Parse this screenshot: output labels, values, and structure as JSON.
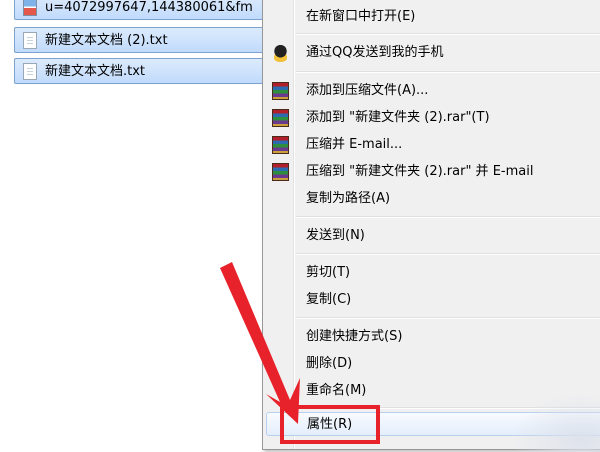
{
  "files": [
    {
      "name": "u=4072997647,144380061&fm",
      "icon": "image-file-icon"
    },
    {
      "name": "新建文本文档 (2).txt",
      "icon": "text-file-icon"
    },
    {
      "name": "新建文本文档.txt",
      "icon": "text-file-icon"
    }
  ],
  "menu": {
    "items": [
      {
        "label": "在新窗口中打开(E)"
      },
      {
        "label": "通过QQ发送到我的手机",
        "icon": "qq-penguin-icon"
      },
      {
        "label": "添加到压缩文件(A)...",
        "icon": "winrar-icon"
      },
      {
        "label": "添加到 \"新建文件夹 (2).rar\"(T)",
        "icon": "winrar-icon"
      },
      {
        "label": "压缩并 E-mail...",
        "icon": "winrar-icon"
      },
      {
        "label": "压缩到 \"新建文件夹 (2).rar\" 并 E-mail",
        "icon": "winrar-icon"
      },
      {
        "label": "复制为路径(A)"
      },
      {
        "label": "发送到(N)"
      },
      {
        "label": "剪切(T)"
      },
      {
        "label": "复制(C)"
      },
      {
        "label": "创建快捷方式(S)"
      },
      {
        "label": "删除(D)"
      },
      {
        "label": "重命名(M)"
      },
      {
        "label": "属性(R)"
      }
    ]
  },
  "annotation": {
    "color": "#e8222a",
    "target": "属性(R)"
  }
}
